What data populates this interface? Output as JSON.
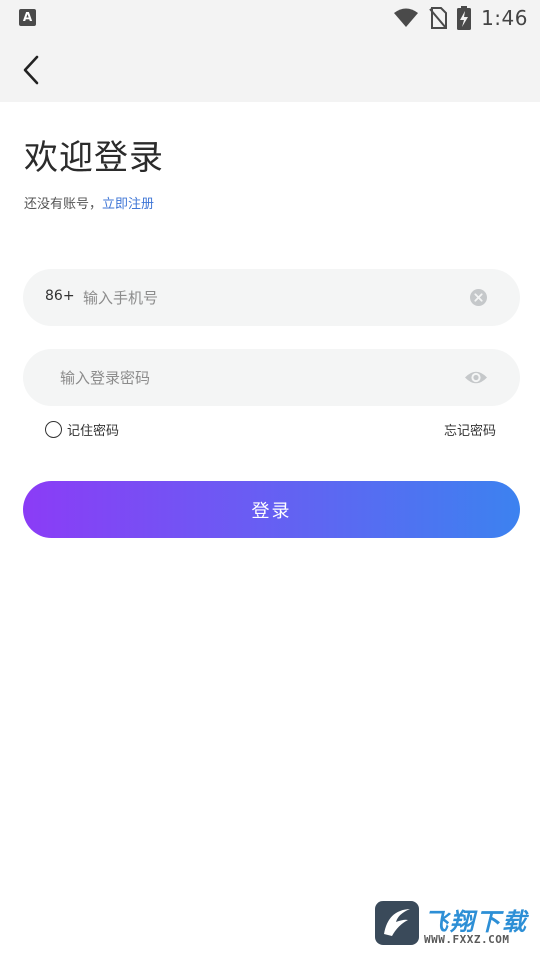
{
  "status_bar": {
    "app_badge": "A",
    "time": "1:46",
    "icons": [
      "wifi-icon",
      "no-sim-icon",
      "battery-charging-icon"
    ]
  },
  "header": {
    "back_icon": "chevron-left-icon"
  },
  "login": {
    "title": "欢迎登录",
    "register_prompt": "还没有账号，",
    "register_link": "立即注册",
    "country_code": "86+",
    "phone_placeholder": "输入手机号",
    "phone_value": "",
    "password_placeholder": "输入登录密码",
    "password_value": "",
    "remember_label": "记住密码",
    "remember_checked": false,
    "forgot_label": "忘记密码",
    "submit_label": "登录"
  },
  "colors": {
    "gradient_start": "#8b3cf6",
    "gradient_end": "#3c82f0",
    "link": "#3f76d6",
    "input_bg": "#f4f5f5",
    "header_bg": "#f3f3f3"
  },
  "watermark": {
    "title": "飞翔下载",
    "url": "WWW.FXXZ.COM"
  }
}
